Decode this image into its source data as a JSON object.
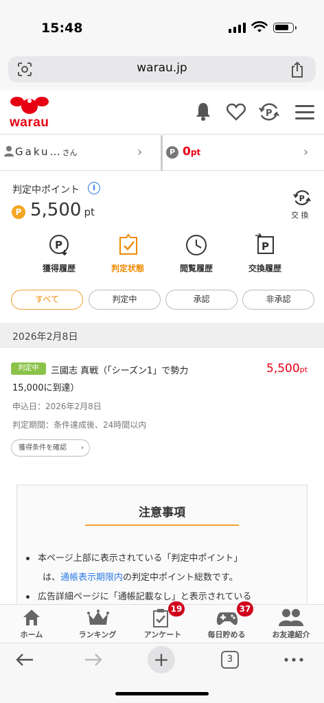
{
  "status": {
    "time": "15:48"
  },
  "browser": {
    "url": "warau.jp",
    "tab_count": "3"
  },
  "site": {
    "logo": "warau"
  },
  "user": {
    "name": "Gaku…",
    "honorific": "さん",
    "points": "0",
    "points_unit": "pt"
  },
  "points_panel": {
    "label": "判定中ポイント",
    "value": "5,500",
    "unit": "pt",
    "exchange_label": "交 換",
    "coin_glyph": "P"
  },
  "nav": [
    {
      "label": "獲得履歴",
      "icon": "earn-history-icon"
    },
    {
      "label": "判定状態",
      "icon": "judgement-status-icon",
      "active": true
    },
    {
      "label": "閲覧履歴",
      "icon": "clock-icon"
    },
    {
      "label": "交換履歴",
      "icon": "exchange-history-icon"
    }
  ],
  "filters": [
    {
      "label": "すべて",
      "active": true
    },
    {
      "label": "判定中"
    },
    {
      "label": "承認"
    },
    {
      "label": "非承認"
    }
  ],
  "date_header": "2026年2月8日",
  "item": {
    "badge": "判定中",
    "title_line1": "三國志 真戦（「シーズン1」で勢力",
    "title_line2": "15,000に到達）",
    "points": "5,500",
    "points_unit": "pt",
    "applied": "申込日：2026年2月8日",
    "period": "判定期間：条件達成後、24時間以内",
    "cond_button": "獲得条件を確認"
  },
  "notice": {
    "title": "注意事項",
    "b1_a": "本ページ上部に表示されている「判定中ポイント」",
    "b1_b_pre": "は、",
    "b1_b_link": "通帳表示期限内",
    "b1_b_post": "の判定中ポイント総数です。",
    "b2": "広告詳細ページに「通帳記載なし」と表示されている"
  },
  "tabbar": [
    {
      "label": "ホーム",
      "icon": "home-icon"
    },
    {
      "label": "ランキング",
      "icon": "crown-icon"
    },
    {
      "label": "アンケート",
      "icon": "survey-icon",
      "badge": "19"
    },
    {
      "label": "毎日貯める",
      "icon": "gamepad-icon",
      "badge": "37"
    },
    {
      "label": "お友達紹介",
      "icon": "friends-icon"
    }
  ],
  "colors": {
    "brand_red": "#e60012",
    "accent_orange": "#f08a00",
    "badge_green": "#8bc34a",
    "link_blue": "#2c7be5"
  }
}
